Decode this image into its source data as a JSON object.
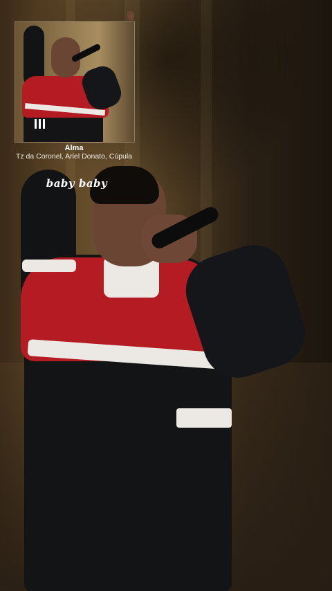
{
  "now_playing": {
    "title": "Alma",
    "artists": "Tz da Coronel, Ariel Donato, Cúpula",
    "lyric_line": "baby baby",
    "playback_control_icon": "pause-icon"
  },
  "colors": {
    "jacket_red": "#b51b22",
    "jacket_black": "#131416",
    "jacket_white": "#ece8e3",
    "stage_gold": "#6e5430"
  }
}
